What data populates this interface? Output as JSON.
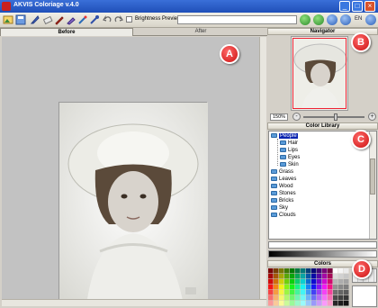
{
  "app": {
    "title": "AKVIS Coloriage v.4.0"
  },
  "toolbar": {
    "brightness_preview_label": "Brightness Preview",
    "language": "EN"
  },
  "tabs": {
    "before": "Before",
    "after": "After"
  },
  "markers": {
    "a": "A",
    "b": "B",
    "c": "C",
    "d": "D"
  },
  "navigator": {
    "title": "Navigator",
    "zoom": "150%",
    "zoom_in": "+",
    "zoom_out": "-"
  },
  "library": {
    "title": "Color Library",
    "items": [
      {
        "label": "People",
        "level": 0,
        "selected": true
      },
      {
        "label": "Hair",
        "level": 1
      },
      {
        "label": "Lips",
        "level": 1
      },
      {
        "label": "Eyes",
        "level": 1
      },
      {
        "label": "Skin",
        "level": 1
      },
      {
        "label": "Grass",
        "level": 0
      },
      {
        "label": "Leaves",
        "level": 0
      },
      {
        "label": "Wood",
        "level": 0
      },
      {
        "label": "Stones",
        "level": 0
      },
      {
        "label": "Bricks",
        "level": 0
      },
      {
        "label": "Sky",
        "level": 0
      },
      {
        "label": "Clouds",
        "level": 0
      }
    ]
  },
  "colors": {
    "title": "Colors"
  }
}
